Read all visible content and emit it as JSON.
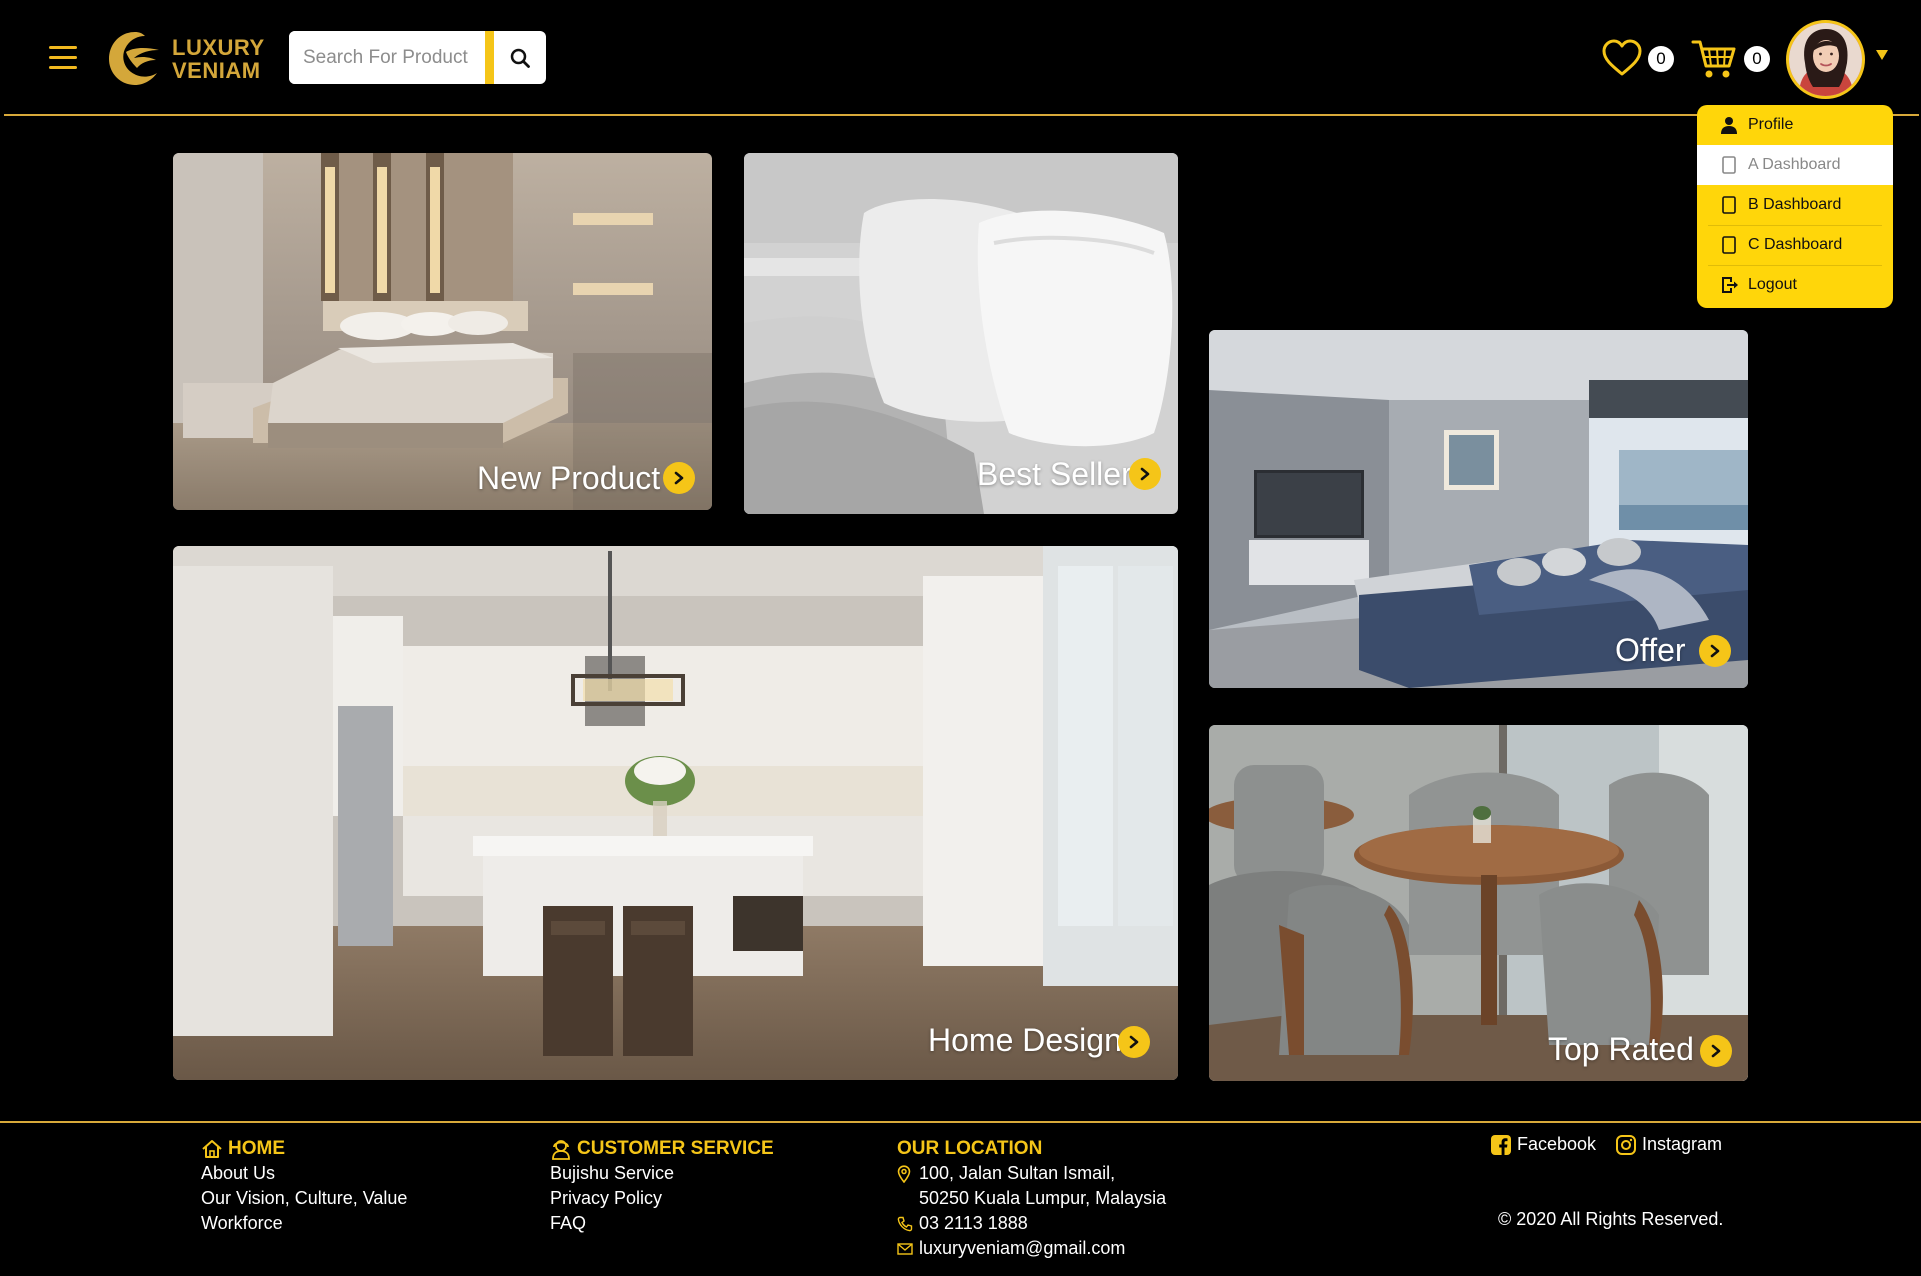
{
  "header": {
    "menu_icon": "hamburger-icon",
    "logo": {
      "line1": "LUXURY",
      "line2": "VENIAM"
    },
    "search": {
      "placeholder": "Search For Product",
      "value": "",
      "button_icon": "search-icon"
    },
    "wishlist": {
      "icon": "heart-icon",
      "count": "0"
    },
    "cart": {
      "icon": "cart-icon",
      "count": "0"
    },
    "user": {
      "avatar": "avatar-photo",
      "caret_icon": "caret-down-icon"
    }
  },
  "dropdown": {
    "items": [
      {
        "label": "Profile",
        "icon": "user-icon"
      },
      {
        "label": "A Dashboard",
        "icon": "document-icon"
      },
      {
        "label": "B Dashboard",
        "icon": "document-icon"
      },
      {
        "label": "C Dashboard",
        "icon": "document-icon"
      },
      {
        "label": "Logout",
        "icon": "logout-icon"
      }
    ],
    "active_index": 1
  },
  "tiles": [
    {
      "label": "New Product",
      "icon": "chevron-right-icon"
    },
    {
      "label": "Best Seller",
      "icon": "chevron-right-icon"
    },
    {
      "label": "Offer",
      "icon": "chevron-right-icon"
    },
    {
      "label": "Home Design",
      "icon": "chevron-right-icon"
    },
    {
      "label": "Top Rated",
      "icon": "chevron-right-icon"
    }
  ],
  "footer": {
    "home": {
      "heading": "HOME",
      "icon": "home-icon",
      "links": [
        "About Us",
        "Our Vision, Culture, Value",
        "Workforce"
      ]
    },
    "customer_service": {
      "heading": "CUSTOMER SERVICE",
      "icon": "customer-service-icon",
      "links": [
        "Bujishu Service",
        "Privacy Policy",
        "FAQ"
      ]
    },
    "location": {
      "heading": "OUR LOCATION",
      "address_line1": "100, Jalan Sultan Ismail,",
      "address_line2": "50250 Kuala Lumpur, Malaysia",
      "phone": "03 2113 1888",
      "email": "luxuryveniam@gmail.com"
    },
    "social": [
      {
        "label": "Facebook",
        "icon": "facebook-icon"
      },
      {
        "label": "Instagram",
        "icon": "instagram-icon"
      }
    ],
    "copyright": "© 2020 All Rights Reserved."
  },
  "colors": {
    "accent": "#f5c518",
    "gold": "#d4a73a",
    "background": "#000000"
  }
}
